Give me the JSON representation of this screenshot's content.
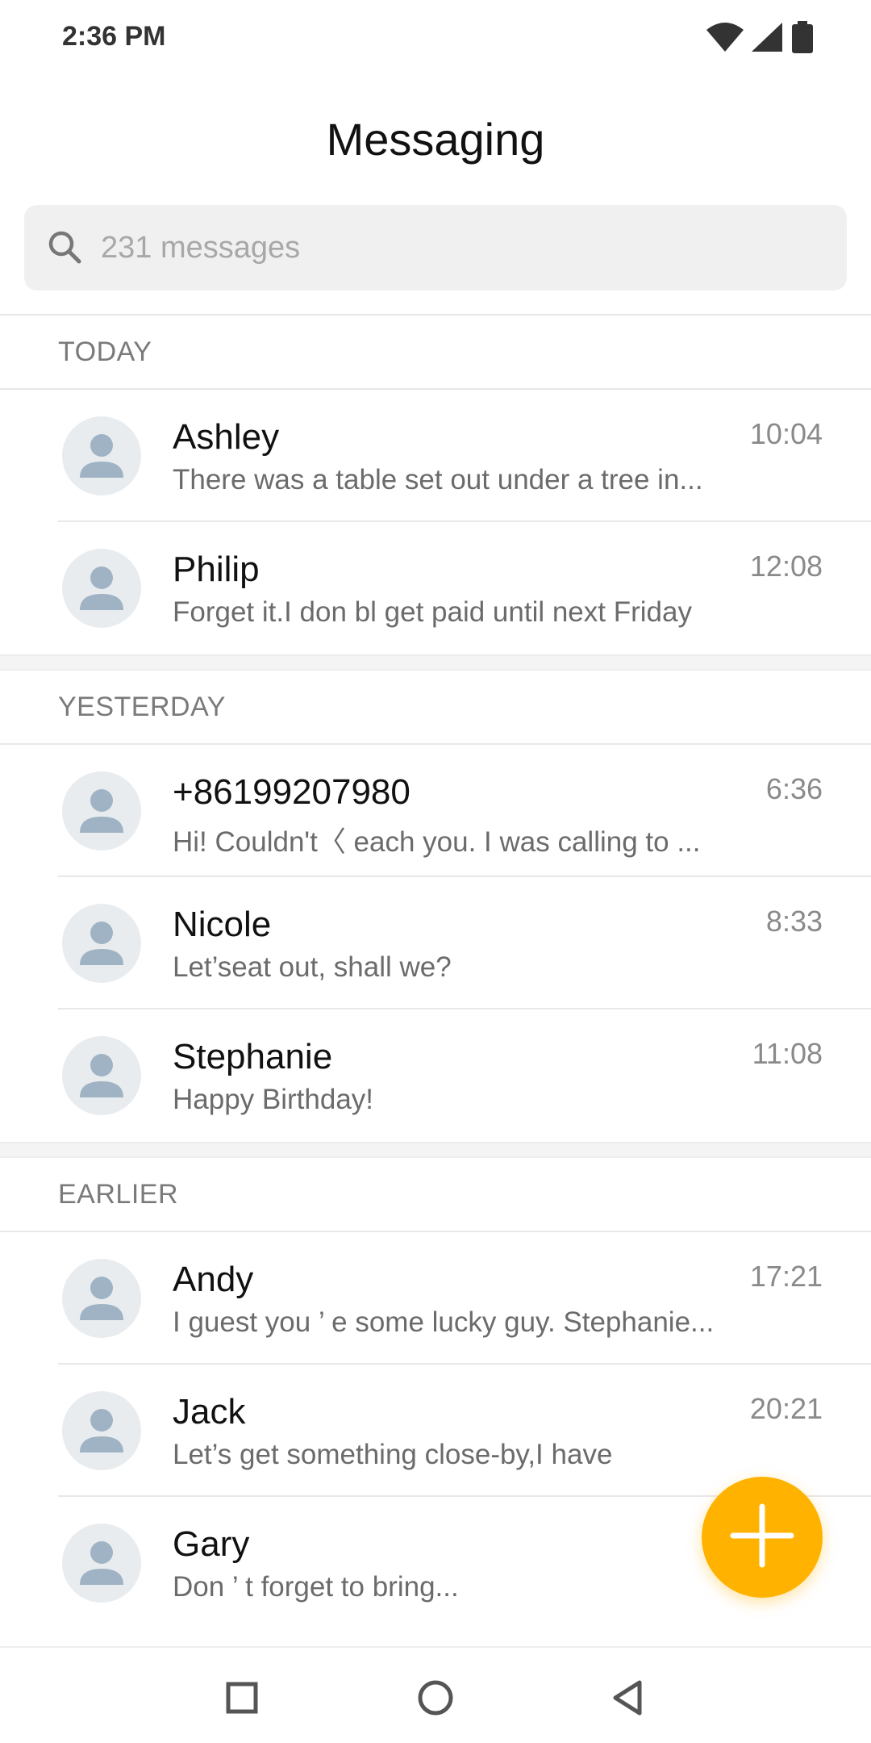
{
  "status": {
    "time": "2:36 PM",
    "icons": [
      "wifi-icon",
      "signal-icon",
      "battery-icon"
    ]
  },
  "header": {
    "title": "Messaging"
  },
  "search": {
    "placeholder": "231 messages"
  },
  "sections": [
    {
      "label": "TODAY",
      "conversations": [
        {
          "name": "Ashley",
          "time": "10:04",
          "preview": "There was a table set out under a tree in..."
        },
        {
          "name": "Philip",
          "time": "12:08",
          "preview": "Forget it.I don bl get paid until next Friday"
        }
      ]
    },
    {
      "label": "YESTERDAY",
      "conversations": [
        {
          "name": "+86199207980",
          "time": "6:36",
          "preview": "Hi! Couldn't〈 each you. I was calling to ..."
        },
        {
          "name": "Nicole",
          "time": "8:33",
          "preview": "Let’seat out, shall we?"
        },
        {
          "name": "Stephanie",
          "time": "11:08",
          "preview": "Happy Birthday!"
        }
      ]
    },
    {
      "label": "EARLIER",
      "conversations": [
        {
          "name": "Andy",
          "time": "17:21",
          "preview": "I guest you ’ e some lucky guy. Stephanie..."
        },
        {
          "name": "Jack",
          "time": "20:21",
          "preview": "Let’s get something close-by,I have"
        },
        {
          "name": "Gary",
          "time": "",
          "preview": "Don ’ t forget to bring..."
        }
      ]
    }
  ],
  "fab": {
    "icon": "plus-icon"
  },
  "navigation": {
    "buttons": [
      "recents-square-icon",
      "home-circle-icon",
      "back-triangle-icon"
    ]
  },
  "colors": {
    "accent": "#ffb300",
    "avatar_bg": "#e9ecef",
    "avatar_fg": "#9fb3c4",
    "search_bg": "#f0f0f0"
  }
}
